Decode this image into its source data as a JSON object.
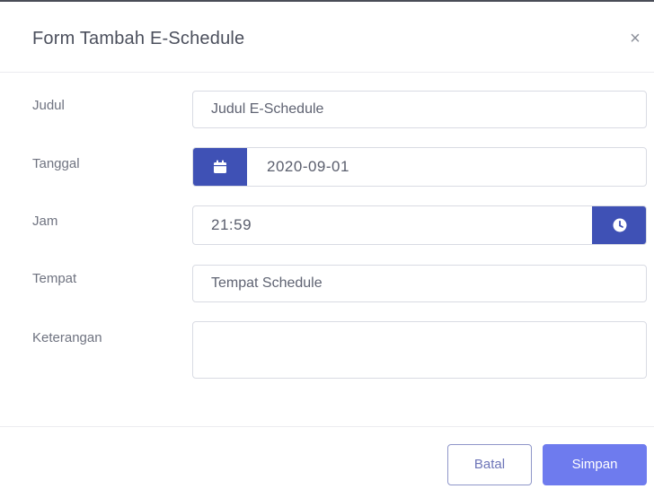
{
  "modal": {
    "title": "Form Tambah E-Schedule",
    "close_glyph": "×"
  },
  "form": {
    "judul": {
      "label": "Judul",
      "value": "Judul E-Schedule"
    },
    "tanggal": {
      "label": "Tanggal",
      "value": "2020-09-01",
      "icon": "calendar-icon"
    },
    "jam": {
      "label": "Jam",
      "value": "21:59",
      "icon": "clock-icon"
    },
    "tempat": {
      "label": "Tempat",
      "value": "Tempat Schedule"
    },
    "keterangan": {
      "label": "Keterangan",
      "value": ""
    }
  },
  "footer": {
    "cancel_label": "Batal",
    "save_label": "Simpan"
  },
  "colors": {
    "accent": "#3f51b5",
    "primary_button": "#6e7bee"
  }
}
